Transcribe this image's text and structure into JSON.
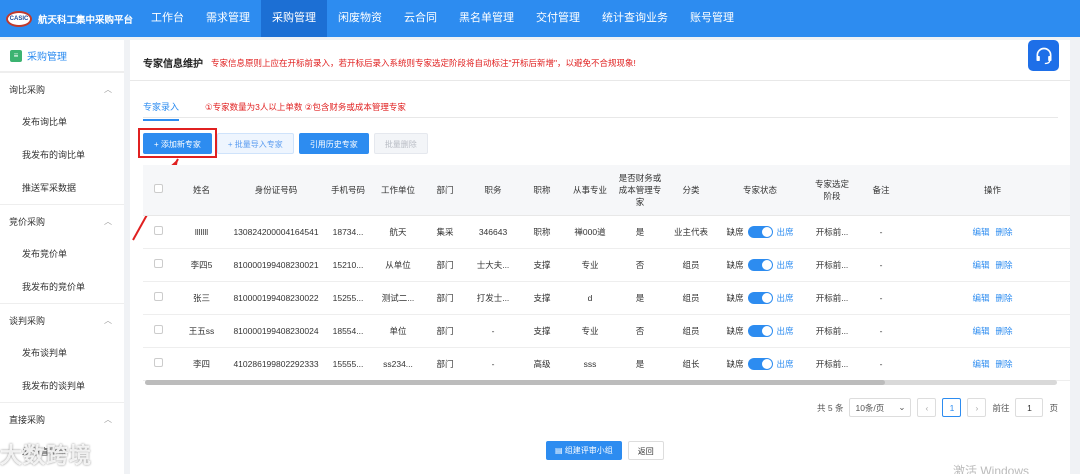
{
  "brand": {
    "logo_text": "CASIC",
    "title": "航天科工集中采购平台"
  },
  "nav": [
    "工作台",
    "需求管理",
    "采购管理",
    "闲废物资",
    "云合同",
    "黑名单管理",
    "交付管理",
    "统计查询业务",
    "账号管理"
  ],
  "sidebar": {
    "title": "采购管理",
    "groups": [
      {
        "label": "询比采购",
        "items": [
          "发布询比单",
          "我发布的询比单",
          "推送军采数据"
        ]
      },
      {
        "label": "竞价采购",
        "items": [
          "发布竞价单",
          "我发布的竞价单"
        ]
      },
      {
        "label": "谈判采购",
        "items": [
          "发布谈判单",
          "我发布的谈判单"
        ]
      },
      {
        "label": "直接采购",
        "items": [
          "发布直采单"
        ]
      }
    ]
  },
  "main": {
    "title": "专家信息维护",
    "hint": "专家信息原则上应在开标前录入，若开标后录入系统则专家选定阶段将自动标注\"开标后新增\"，以避免不合规现象!",
    "tab": "专家录入",
    "tab_note": "①专家数量为3人以上单数 ②包含财务或成本管理专家",
    "buttons": {
      "add": "+ 添加新专家",
      "import": "+ 批量导入专家",
      "history": "引用历史专家",
      "batch_delete": "批量删除"
    }
  },
  "table": {
    "headers": [
      "姓名",
      "身份证号码",
      "手机号码",
      "工作单位",
      "部门",
      "职务",
      "职称",
      "从事专业",
      "是否财务或成本管理专家",
      "分类",
      "专家状态",
      "专家选定阶段",
      "备注",
      "操作"
    ],
    "rows": [
      [
        "lllllll",
        "130824200004164541",
        "18734...",
        "航天",
        "集采",
        "346643",
        "职称",
        "禅000道",
        "是",
        "业主代表",
        "开标前...",
        "-"
      ],
      [
        "李四5",
        "810000199408230021",
        "15210...",
        "从单位",
        "部门",
        "士大夫...",
        "支撑",
        "专业",
        "否",
        "组员",
        "开标前...",
        "-"
      ],
      [
        "张三",
        "810000199408230022",
        "15255...",
        "测试二...",
        "部门",
        "打发士...",
        "支撑",
        "d",
        "是",
        "组员",
        "开标前...",
        "-"
      ],
      [
        "王五ss",
        "810000199408230024",
        "18554...",
        "单位",
        "部门",
        "-",
        "支撑",
        "专业",
        "否",
        "组员",
        "开标前...",
        "-"
      ],
      [
        "李四",
        "410286199802292333",
        "15555...",
        "ss234...",
        "部门",
        "-",
        "高级",
        "sss",
        "是",
        "组长",
        "开标前...",
        "-"
      ]
    ],
    "switch_off_label": "缺席",
    "switch_on_label": "出席",
    "edit_label": "编辑",
    "delete_label": "删除"
  },
  "pager": {
    "total": "共 5 条",
    "page_size": "10条/页",
    "current": "1",
    "goto_label": "前往",
    "goto_value": "1",
    "page_suffix": "页"
  },
  "footer": {
    "submit": "组建评审小组",
    "back": "返回"
  },
  "watermark": "大数跨境",
  "windows_text": "激活 Windows"
}
